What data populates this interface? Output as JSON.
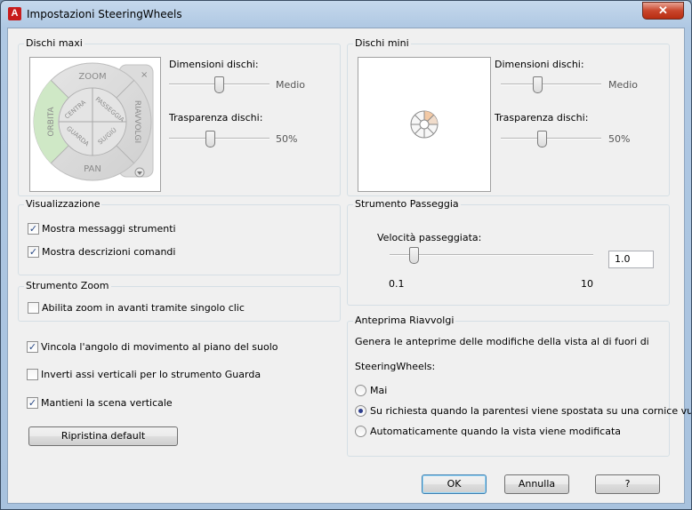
{
  "window": {
    "title": "Impostazioni SteeringWheels",
    "close_label": "✕"
  },
  "big_wheels": {
    "label": "Dischi maxi",
    "wheel": {
      "zoom": "ZOOM",
      "orbit": "ORBITA",
      "rewind": "RIAVVOLGI",
      "pan": "PAN",
      "center": "CENTRA",
      "walk": "PASSEGGIA",
      "look": "GUARDA",
      "updown": "SU/GIÙ"
    },
    "size_label": "Dimensioni dischi:",
    "size_value": "Medio",
    "size_level": 0.5,
    "opacity_label": "Trasparenza dischi:",
    "opacity_value": "50%",
    "opacity_level": 0.4
  },
  "mini_wheels": {
    "label": "Dischi mini",
    "size_label": "Dimensioni dischi:",
    "size_value": "Medio",
    "size_level": 0.35,
    "opacity_label": "Trasparenza dischi:",
    "opacity_value": "50%",
    "opacity_level": 0.4
  },
  "display": {
    "label": "Visualizzazione",
    "show_tool_messages": {
      "label": "Mostra messaggi strumenti",
      "checked": true
    },
    "show_tooltips": {
      "label": "Mostra descrizioni comandi",
      "checked": true
    }
  },
  "walk_tool": {
    "label": "Strumento Passeggia",
    "speed_label": "Velocità passeggiata:",
    "speed_value": "1.0",
    "min_label": "0.1",
    "max_label": "10",
    "speed_level": 0.1
  },
  "zoom_tool": {
    "label": "Strumento Zoom",
    "single_click": {
      "label": "Abilita zoom in avanti tramite singolo clic",
      "checked": false
    }
  },
  "options": {
    "constrain_orbit": {
      "label": "Vincola l'angolo di movimento al piano del suolo",
      "checked": true
    },
    "invert_look": {
      "label": "Inverti assi verticali per lo strumento Guarda",
      "checked": false
    },
    "keep_upright": {
      "label": "Mantieni la scena verticale",
      "checked": true
    }
  },
  "rewind_preview": {
    "label": "Anteprima Riavvolgi",
    "description_line1": "Genera le anteprime delle modifiche della vista al di fuori di",
    "description_line2": "SteeringWheels:",
    "never": {
      "label": "Mai",
      "selected": false
    },
    "on_demand": {
      "label": "Su richiesta quando la parentesi viene spostata su una cornice vuota",
      "selected": true
    },
    "automatic": {
      "label": "Automaticamente quando la vista viene modificata",
      "selected": false
    }
  },
  "buttons": {
    "restore_defaults": "Ripristina default",
    "ok": "OK",
    "cancel": "Annulla",
    "help": "?"
  },
  "icons": {
    "app": "autocad-icon",
    "close": "close-icon"
  }
}
